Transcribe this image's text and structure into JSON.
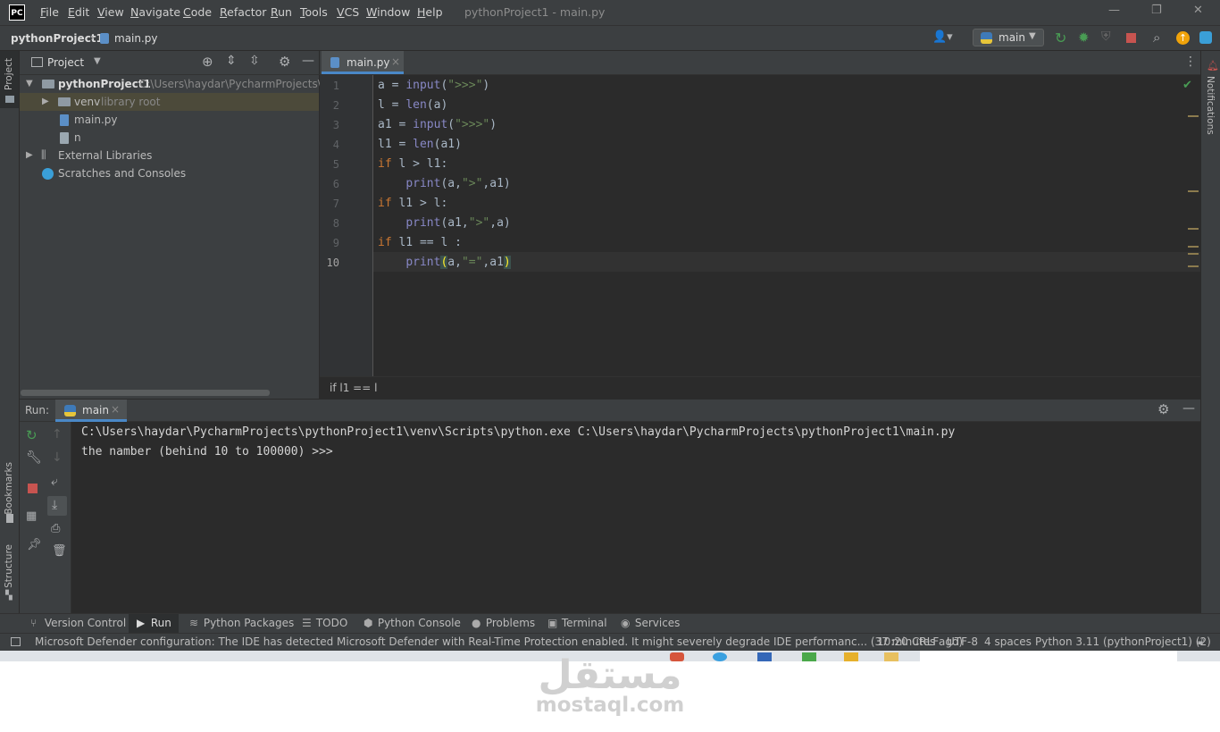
{
  "app": {
    "logo": "PC",
    "window_title": "pythonProject1 - main.py"
  },
  "menu": [
    "File",
    "Edit",
    "View",
    "Navigate",
    "Code",
    "Refactor",
    "Run",
    "Tools",
    "VCS",
    "Window",
    "Help"
  ],
  "window_controls": {
    "minimize": "—",
    "restore": "❐",
    "close": "✕"
  },
  "navbar": {
    "project": "pythonProject1",
    "separator": "›",
    "file": "main.py",
    "run_config": "main"
  },
  "project_panel": {
    "title": "Project",
    "tree": [
      {
        "label": "pythonProject1",
        "hint": "C:\\Users\\haydar\\PycharmProjects\\pyt",
        "type": "project-root",
        "expanded": true
      },
      {
        "label": "venv",
        "hint": "library root",
        "type": "folder",
        "expanded": false
      },
      {
        "label": "main.py",
        "hint": "",
        "type": "python-file"
      },
      {
        "label": "n",
        "hint": "",
        "type": "file"
      },
      {
        "label": "External Libraries",
        "hint": "",
        "type": "libraries",
        "expanded": false
      },
      {
        "label": "Scratches and Consoles",
        "hint": "",
        "type": "scratches"
      }
    ]
  },
  "editor": {
    "tab": "main.py",
    "tab_close": "×",
    "line_numbers": [
      "1",
      "2",
      "3",
      "4",
      "5",
      "6",
      "7",
      "8",
      "9",
      "10"
    ],
    "current_line": "10",
    "breadcrumb": "if l1 == l"
  },
  "left_stripe": {
    "project": "Project",
    "bookmarks": "Bookmarks",
    "structure": "Structure"
  },
  "right_stripe": {
    "notifications": "Notifications"
  },
  "run_panel": {
    "label": "Run:",
    "tab": "main",
    "tab_close": "×",
    "output": [
      "C:\\Users\\haydar\\PycharmProjects\\pythonProject1\\venv\\Scripts\\python.exe C:\\Users\\haydar\\PycharmProjects\\pythonProject1\\main.py",
      "the namber (behind 10 to 100000) >>>"
    ]
  },
  "tool_windows": [
    "Version Control",
    "Run",
    "Python Packages",
    "TODO",
    "Python Console",
    "Problems",
    "Terminal",
    "Services"
  ],
  "status_bar": {
    "message": "Microsoft Defender configuration: The IDE has detected Microsoft Defender with Real-Time Protection enabled. It might severely degrade IDE performanc... (37 minutes ago)",
    "position": "10:20",
    "line_sep": "CRLF",
    "encoding": "UTF-8",
    "indent": "4 spaces",
    "interpreter": "Python 3.11 (pythonProject1) (2)"
  },
  "watermark": {
    "arabic": "مستقل",
    "latin": "mostaql.com"
  },
  "colors": {
    "accent": "#4a88c7",
    "keyword": "#cc7832",
    "builtin": "#8888c6",
    "string": "#6a8759",
    "run_green": "#499c54",
    "stop_red": "#c75450"
  }
}
